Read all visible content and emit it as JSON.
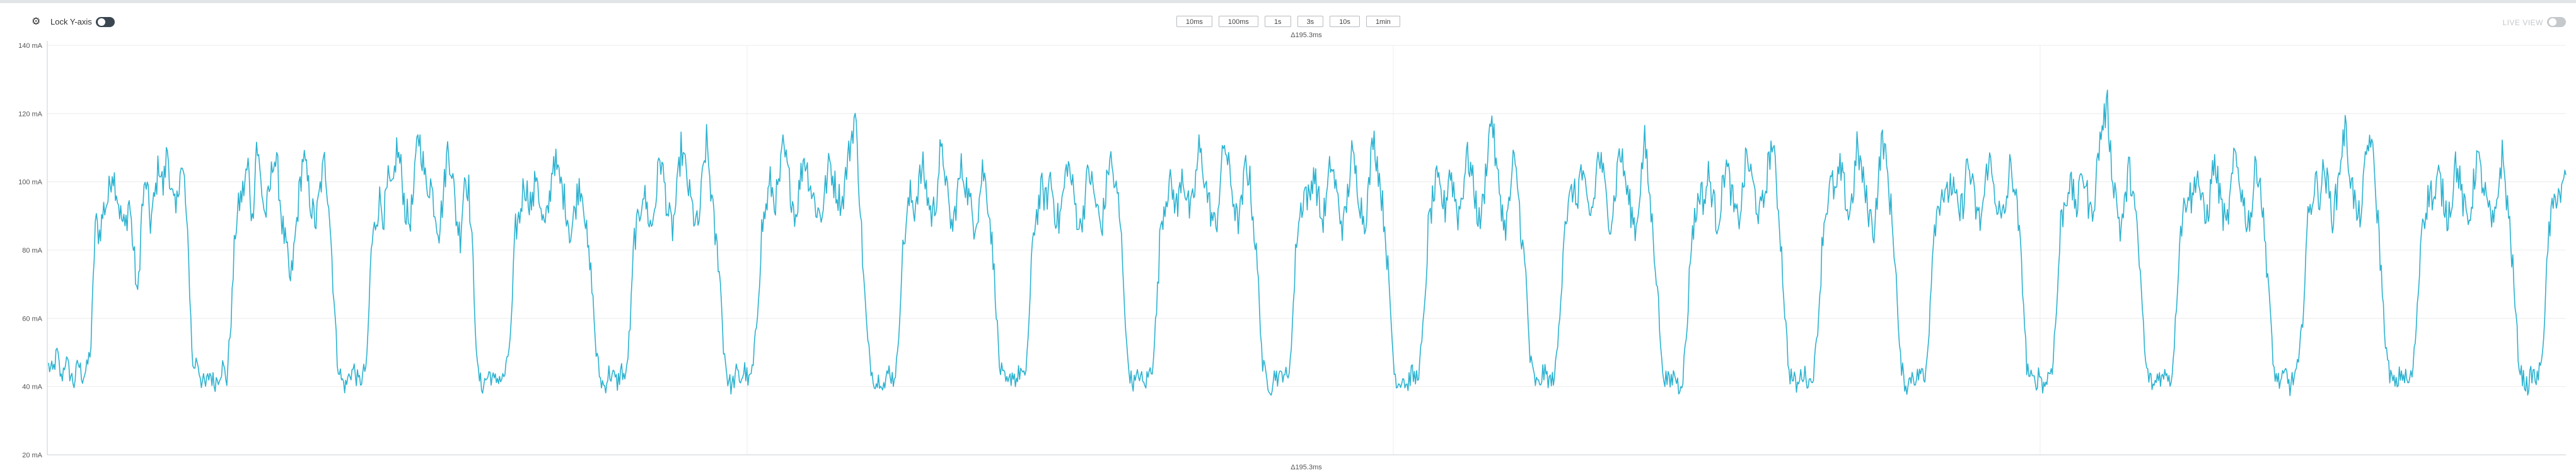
{
  "toolbar": {
    "settings_icon": "gear-icon",
    "lock_label": "Lock Y-axis",
    "lock_enabled": true,
    "live_label": "LIVE VIEW",
    "live_enabled": false,
    "ranges": [
      "10ms",
      "100ms",
      "1s",
      "3s",
      "10s",
      "1min"
    ]
  },
  "chart_data": {
    "type": "line",
    "title": "",
    "xlabel": "",
    "ylabel": "",
    "ylim": [
      20,
      140
    ],
    "yticks": [
      20,
      40,
      60,
      80,
      100,
      120,
      140
    ],
    "yunit": "mA",
    "ytick_labels": [
      "20 mA",
      "40 mA",
      "60 mA",
      "80 mA",
      "100 mA",
      "120 mA",
      "140 mA"
    ],
    "window_label_top": "Δ195.3ms",
    "window_label_bottom": "Δ195.3ms",
    "grid": true,
    "line_color": "#2cb2d0",
    "series": [
      {
        "values": [
          46,
          44,
          50,
          42,
          48,
          44,
          41,
          47,
          43,
          45,
          52,
          88,
          85,
          92,
          95,
          104,
          98,
          90,
          86,
          95,
          80,
          66,
          92,
          100,
          88,
          95,
          106,
          98,
          110,
          96,
          90,
          105,
          100,
          76,
          45,
          48,
          42,
          40,
          44,
          41,
          43,
          46,
          42,
          60,
          86,
          94,
          98,
          105,
          88,
          112,
          100,
          90,
          96,
          108,
          103,
          88,
          80,
          70,
          82,
          96,
          108,
          100,
          92,
          88,
          98,
          106,
          95,
          72,
          48,
          42,
          40,
          44,
          45,
          41,
          43,
          47,
          80,
          88,
          95,
          90,
          100,
          96,
          110,
          104,
          92,
          88,
          96,
          115,
          108,
          98,
          100,
          92,
          86,
          96,
          110,
          104,
          90,
          84,
          102,
          98,
          75,
          45,
          40,
          42,
          44,
          41,
          43,
          42,
          46,
          58,
          86,
          90,
          100,
          96,
          93,
          104,
          90,
          86,
          95,
          108,
          102,
          98,
          92,
          84,
          92,
          100,
          96,
          80,
          70,
          50,
          42,
          40,
          44,
          43,
          41,
          45,
          42,
          58,
          84,
          88,
          98,
          92,
          86,
          95,
          108,
          100,
          90,
          86,
          96,
          110,
          104,
          96,
          90,
          86,
          100,
          112,
          98,
          84,
          76,
          52,
          42,
          40,
          44,
          42,
          45,
          41,
          46,
          62,
          86,
          92,
          100,
          94,
          98,
          110,
          104,
          96,
          90,
          100,
          108,
          102,
          96,
          92,
          90,
          98,
          106,
          100,
          96,
          94,
          104,
          112,
          120,
          98,
          72,
          52,
          44,
          41,
          43,
          40,
          45,
          42,
          48,
          76,
          88,
          96,
          92,
          100,
          104,
          96,
          90,
          94,
          108,
          106,
          92,
          86,
          96,
          104,
          100,
          94,
          88,
          92,
          104,
          98,
          86,
          68,
          46,
          42,
          40,
          44,
          42,
          45,
          41,
          60,
          86,
          92,
          98,
          94,
          102,
          92,
          88,
          96,
          106,
          100,
          92,
          86,
          94,
          104,
          98,
          92,
          86,
          96,
          108,
          100,
          94,
          78,
          50,
          42,
          41,
          44,
          40,
          43,
          46,
          62,
          88,
          94,
          100,
          96,
          92,
          104,
          96,
          90,
          98,
          110,
          104,
          96,
          90,
          86,
          100,
          112,
          104,
          96,
          88,
          92,
          106,
          100,
          86,
          70,
          46,
          42,
          40,
          44,
          42,
          45,
          41,
          58,
          84,
          92,
          98,
          94,
          104,
          96,
          88,
          94,
          106,
          100,
          92,
          86,
          96,
          108,
          102,
          94,
          88,
          98,
          114,
          106,
          96,
          84,
          64,
          44,
          41,
          43,
          40,
          44,
          42,
          46,
          60,
          86,
          94,
          100,
          96,
          92,
          104,
          98,
          90,
          96,
          108,
          104,
          96,
          88,
          94,
          110,
          120,
          104,
          96,
          86,
          92,
          106,
          100,
          84,
          72,
          48,
          42,
          40,
          44,
          43,
          41,
          45,
          60,
          88,
          92,
          98,
          94,
          104,
          96,
          90,
          94,
          108,
          104,
          94,
          88,
          96,
          110,
          104,
          96,
          90,
          86,
          100,
          112,
          98,
          84,
          70,
          46,
          42,
          41,
          44,
          40,
          43,
          58,
          84,
          90,
          98,
          94,
          102,
          96,
          88,
          94,
          106,
          100,
          92,
          88,
          96,
          108,
          102,
          96,
          90,
          94,
          104,
          112,
          100,
          84,
          62,
          44,
          42,
          40,
          44,
          43,
          41,
          46,
          62,
          86,
          94,
          100,
          96,
          104,
          98,
          90,
          96,
          110,
          104,
          96,
          90,
          86,
          100,
          114,
          104,
          92,
          78,
          50,
          42,
          40,
          44,
          42,
          45,
          41,
          58,
          86,
          92,
          98,
          94,
          100,
          96,
          90,
          94,
          106,
          100,
          92,
          88,
          96,
          108,
          100,
          94,
          88,
          92,
          104,
          100,
          88,
          70,
          46,
          42,
          41,
          44,
          40,
          43,
          46,
          62,
          88,
          94,
          100,
          96,
          92,
          104,
          98,
          90,
          96,
          110,
          118,
          122,
          104,
          96,
          86,
          92,
          104,
          98,
          84,
          68,
          46,
          42,
          40,
          44,
          42,
          45,
          41,
          58,
          84,
          92,
          98,
          94,
          104,
          96,
          88,
          94,
          106,
          100,
          92,
          86,
          96,
          108,
          102,
          94,
          88,
          92,
          106,
          100,
          84,
          70,
          46,
          42,
          41,
          44,
          40,
          43,
          46,
          60,
          86,
          94,
          100,
          96,
          104,
          98,
          90,
          96,
          108,
          116,
          104,
          96,
          88,
          94,
          108,
          114,
          100,
          84,
          62,
          46,
          42,
          40,
          44,
          43,
          41,
          45,
          62,
          88,
          92,
          98,
          94,
          102,
          96,
          90,
          94,
          106,
          100,
          92,
          88,
          96,
          108,
          102,
          96,
          90,
          86,
          98,
          108,
          96,
          84,
          64,
          46,
          42,
          40,
          44,
          42,
          45,
          60,
          86,
          92,
          98,
          96,
          102
        ]
      }
    ]
  }
}
